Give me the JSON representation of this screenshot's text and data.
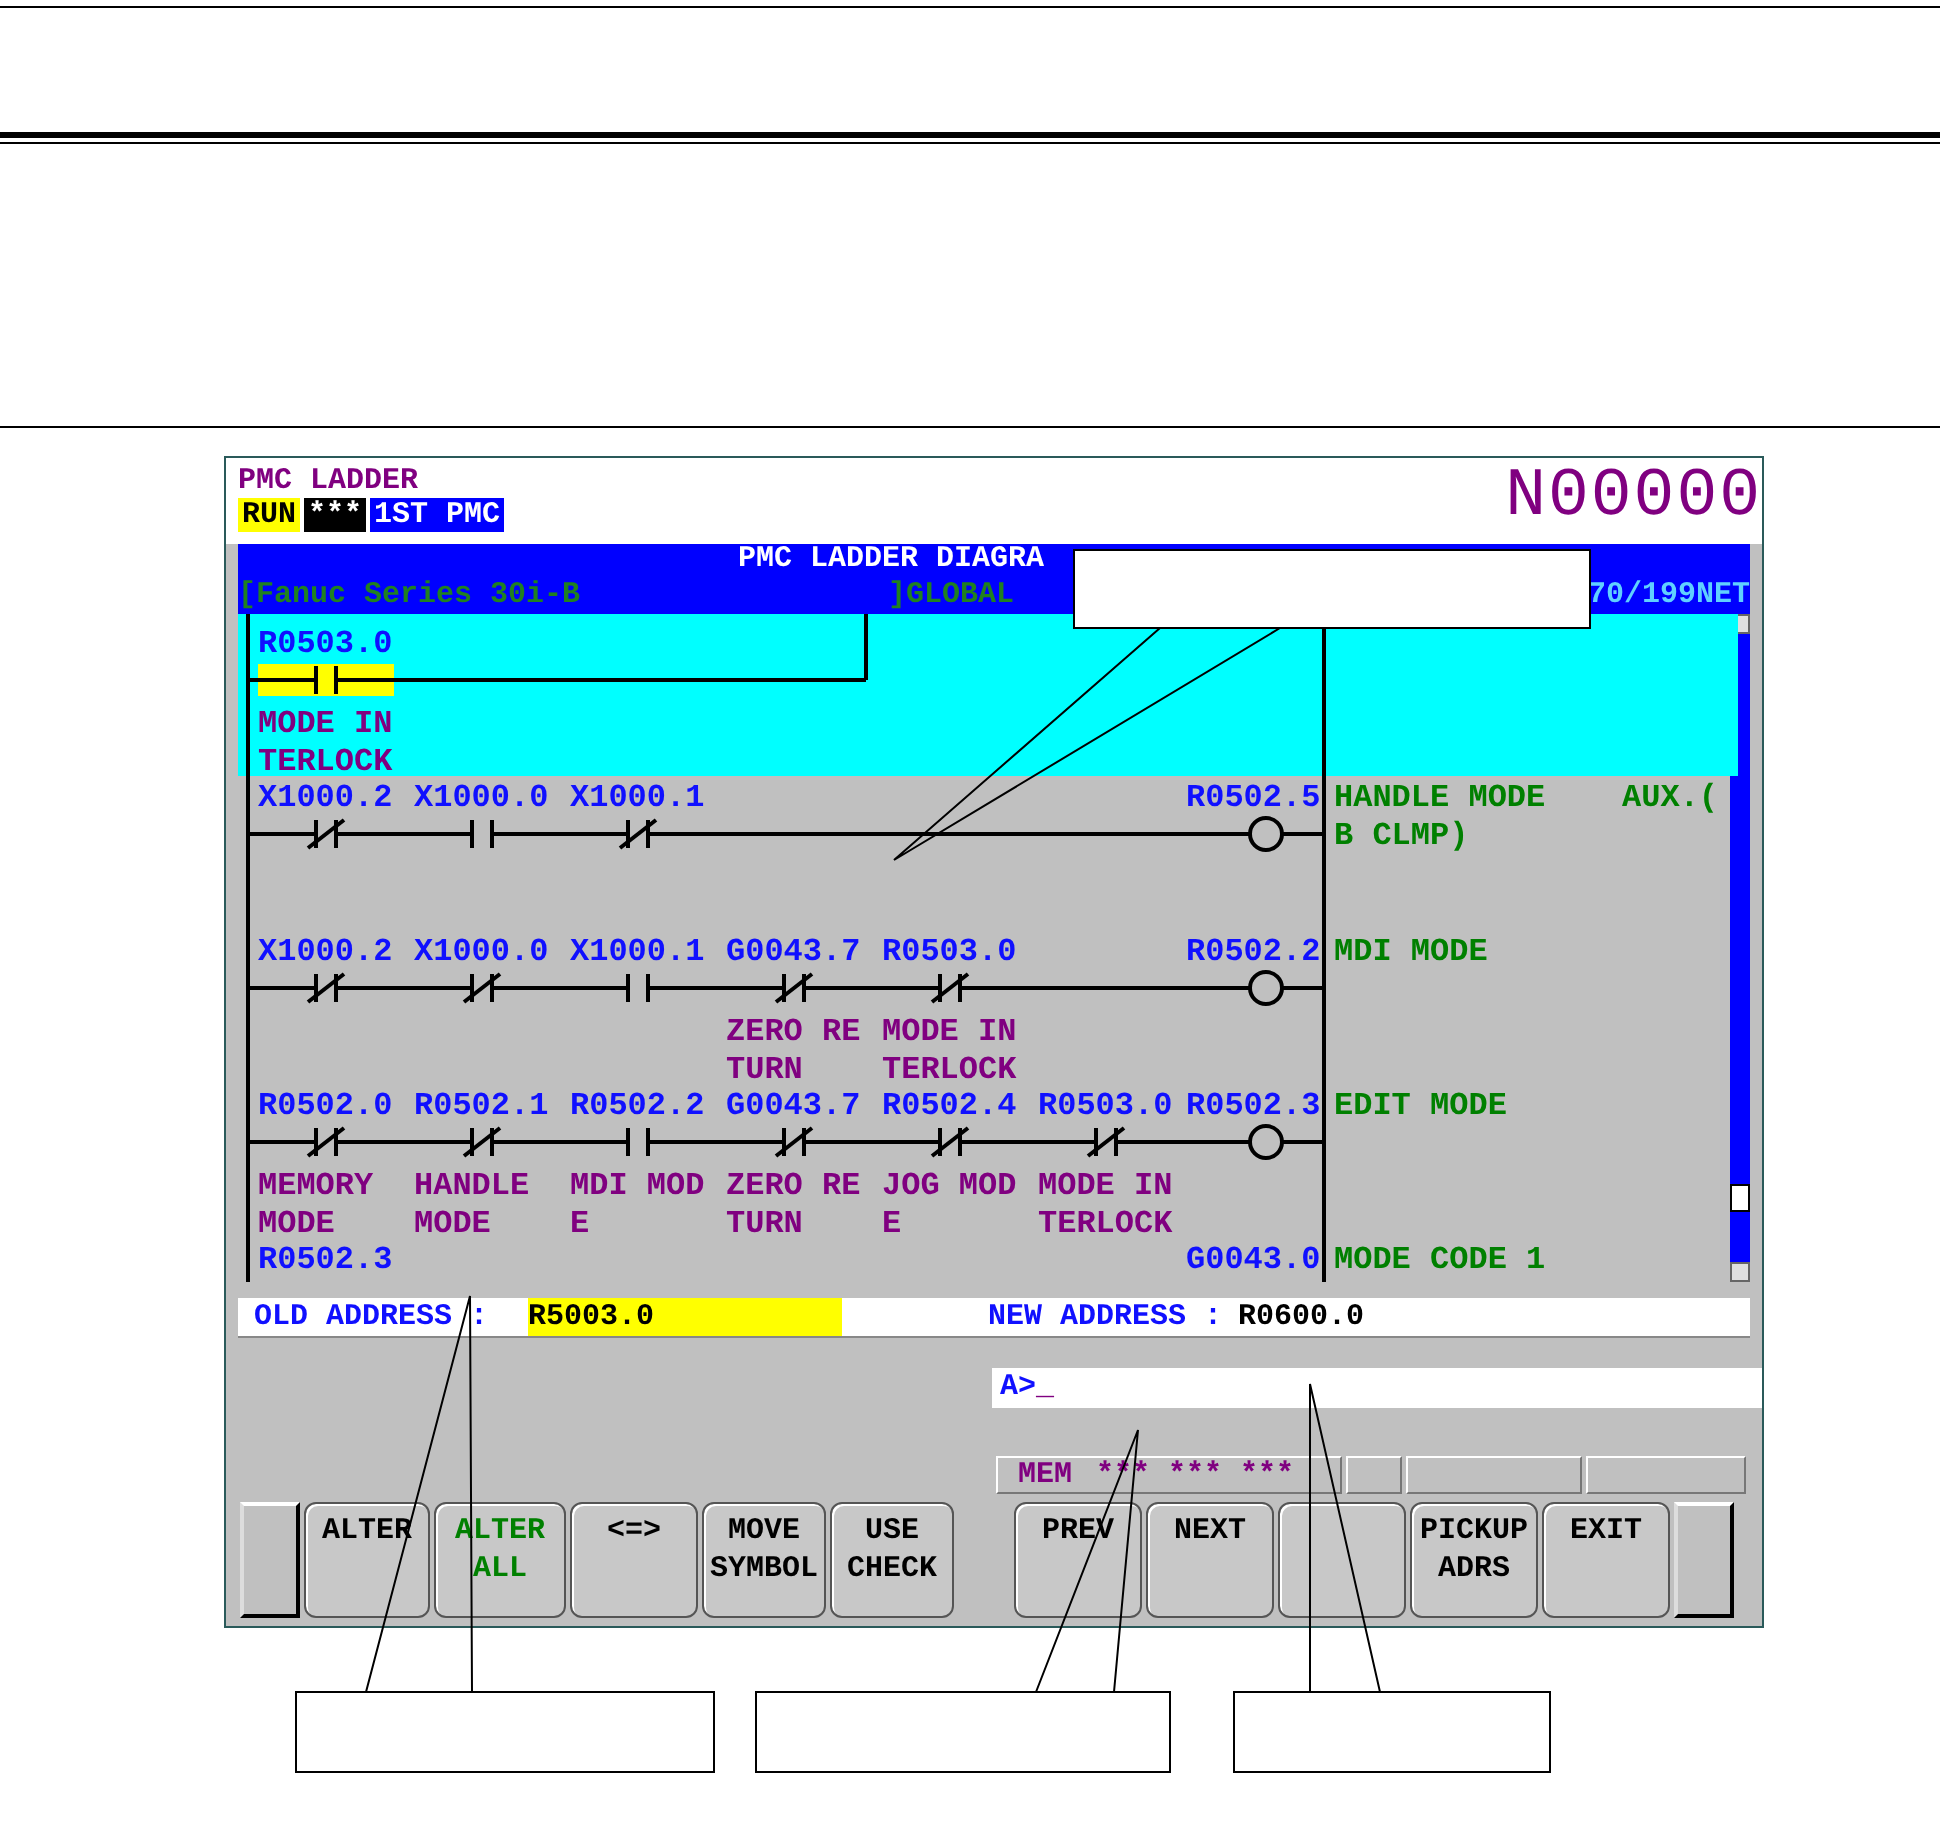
{
  "screen": {
    "title": "PMC LADDER",
    "status": [
      {
        "text": "RUN",
        "kind": "run"
      },
      {
        "text": "***",
        "kind": "alarm"
      },
      {
        "text": "1ST PMC",
        "kind": "pmc"
      }
    ],
    "program_number": "N00000"
  },
  "diagram_header": {
    "title": "PMC LADDER DIAGRA",
    "subtitle": "[Fanuc Series 30i-B",
    "scope": "]GLOBAL",
    "net": "70/199NET"
  },
  "rungs": [
    {
      "selected": true,
      "contacts": [
        {
          "address": "R0503.0",
          "kind": "no",
          "comment": [
            "MODE IN",
            "TERLOCK"
          ]
        }
      ]
    },
    {
      "selected": false,
      "contacts": [
        {
          "address": "X1000.2",
          "kind": "nc"
        },
        {
          "address": "X1000.0",
          "kind": "no"
        },
        {
          "address": "X1000.1",
          "kind": "nc"
        }
      ],
      "coil": {
        "address": "R0502.5",
        "kind": "coil",
        "comment": [
          "HANDLE MODE    AUX.(",
          "B CLMP)"
        ]
      }
    },
    {
      "selected": false,
      "contacts": [
        {
          "address": "X1000.2",
          "kind": "nc"
        },
        {
          "address": "X1000.0",
          "kind": "nc"
        },
        {
          "address": "X1000.1",
          "kind": "no"
        },
        {
          "address": "G0043.7",
          "kind": "nc",
          "comment": [
            "ZERO RE",
            "TURN"
          ]
        },
        {
          "address": "R0503.0",
          "kind": "nc",
          "comment": [
            "MODE IN",
            "TERLOCK"
          ]
        }
      ],
      "coil": {
        "address": "R0502.2",
        "kind": "coil",
        "comment": [
          "MDI MODE"
        ]
      }
    },
    {
      "selected": false,
      "contacts": [
        {
          "address": "R0502.0",
          "kind": "nc",
          "comment": [
            "MEMORY",
            "MODE"
          ]
        },
        {
          "address": "R0502.1",
          "kind": "nc",
          "comment": [
            "HANDLE",
            "MODE"
          ]
        },
        {
          "address": "R0502.2",
          "kind": "no",
          "comment": [
            "MDI MOD",
            "E"
          ]
        },
        {
          "address": "G0043.7",
          "kind": "nc",
          "comment": [
            "ZERO RE",
            "TURN"
          ]
        },
        {
          "address": "R0502.4",
          "kind": "nc",
          "comment": [
            "JOG MOD",
            "E"
          ]
        },
        {
          "address": "R0503.0",
          "kind": "nc",
          "comment": [
            "MODE IN",
            "TERLOCK"
          ]
        }
      ],
      "coil": {
        "address": "R0502.3",
        "kind": "coil",
        "comment": [
          "EDIT MODE"
        ]
      }
    },
    {
      "selected": false,
      "contacts": [
        {
          "address": "R0502.3"
        }
      ],
      "coil": {
        "address": "G0043.0",
        "comment": [
          "MODE CODE 1"
        ]
      }
    }
  ],
  "address_bar": {
    "old_label": "OLD ADDRESS :",
    "old_value": "R5003.0",
    "new_label": "NEW ADDRESS :",
    "new_value": "R0600.0"
  },
  "command_line": {
    "prompt": "A>",
    "cursor": "_"
  },
  "status_row": {
    "mode": "MEM",
    "flags": "*** *** ***"
  },
  "softkeys": [
    {
      "kind": "label",
      "lines": [
        "ALTER"
      ],
      "color": "#000000"
    },
    {
      "kind": "label",
      "lines": [
        "ALTER",
        "ALL"
      ],
      "color": "#008000"
    },
    {
      "kind": "label",
      "lines": [
        "<=>"
      ],
      "color": "#000000"
    },
    {
      "kind": "label",
      "lines": [
        "MOVE",
        "SYMBOL"
      ],
      "color": "#000000"
    },
    {
      "kind": "label",
      "lines": [
        "USE",
        "CHECK"
      ],
      "color": "#000000"
    },
    {
      "kind": "label",
      "lines": [
        "PREV"
      ],
      "color": "#000000"
    },
    {
      "kind": "label",
      "lines": [
        "NEXT"
      ],
      "color": "#000000"
    },
    {
      "kind": "blank"
    },
    {
      "kind": "label",
      "lines": [
        "PICKUP",
        "ADRS"
      ],
      "color": "#000000"
    },
    {
      "kind": "label",
      "lines": [
        "EXIT"
      ],
      "color": "#000000"
    }
  ]
}
